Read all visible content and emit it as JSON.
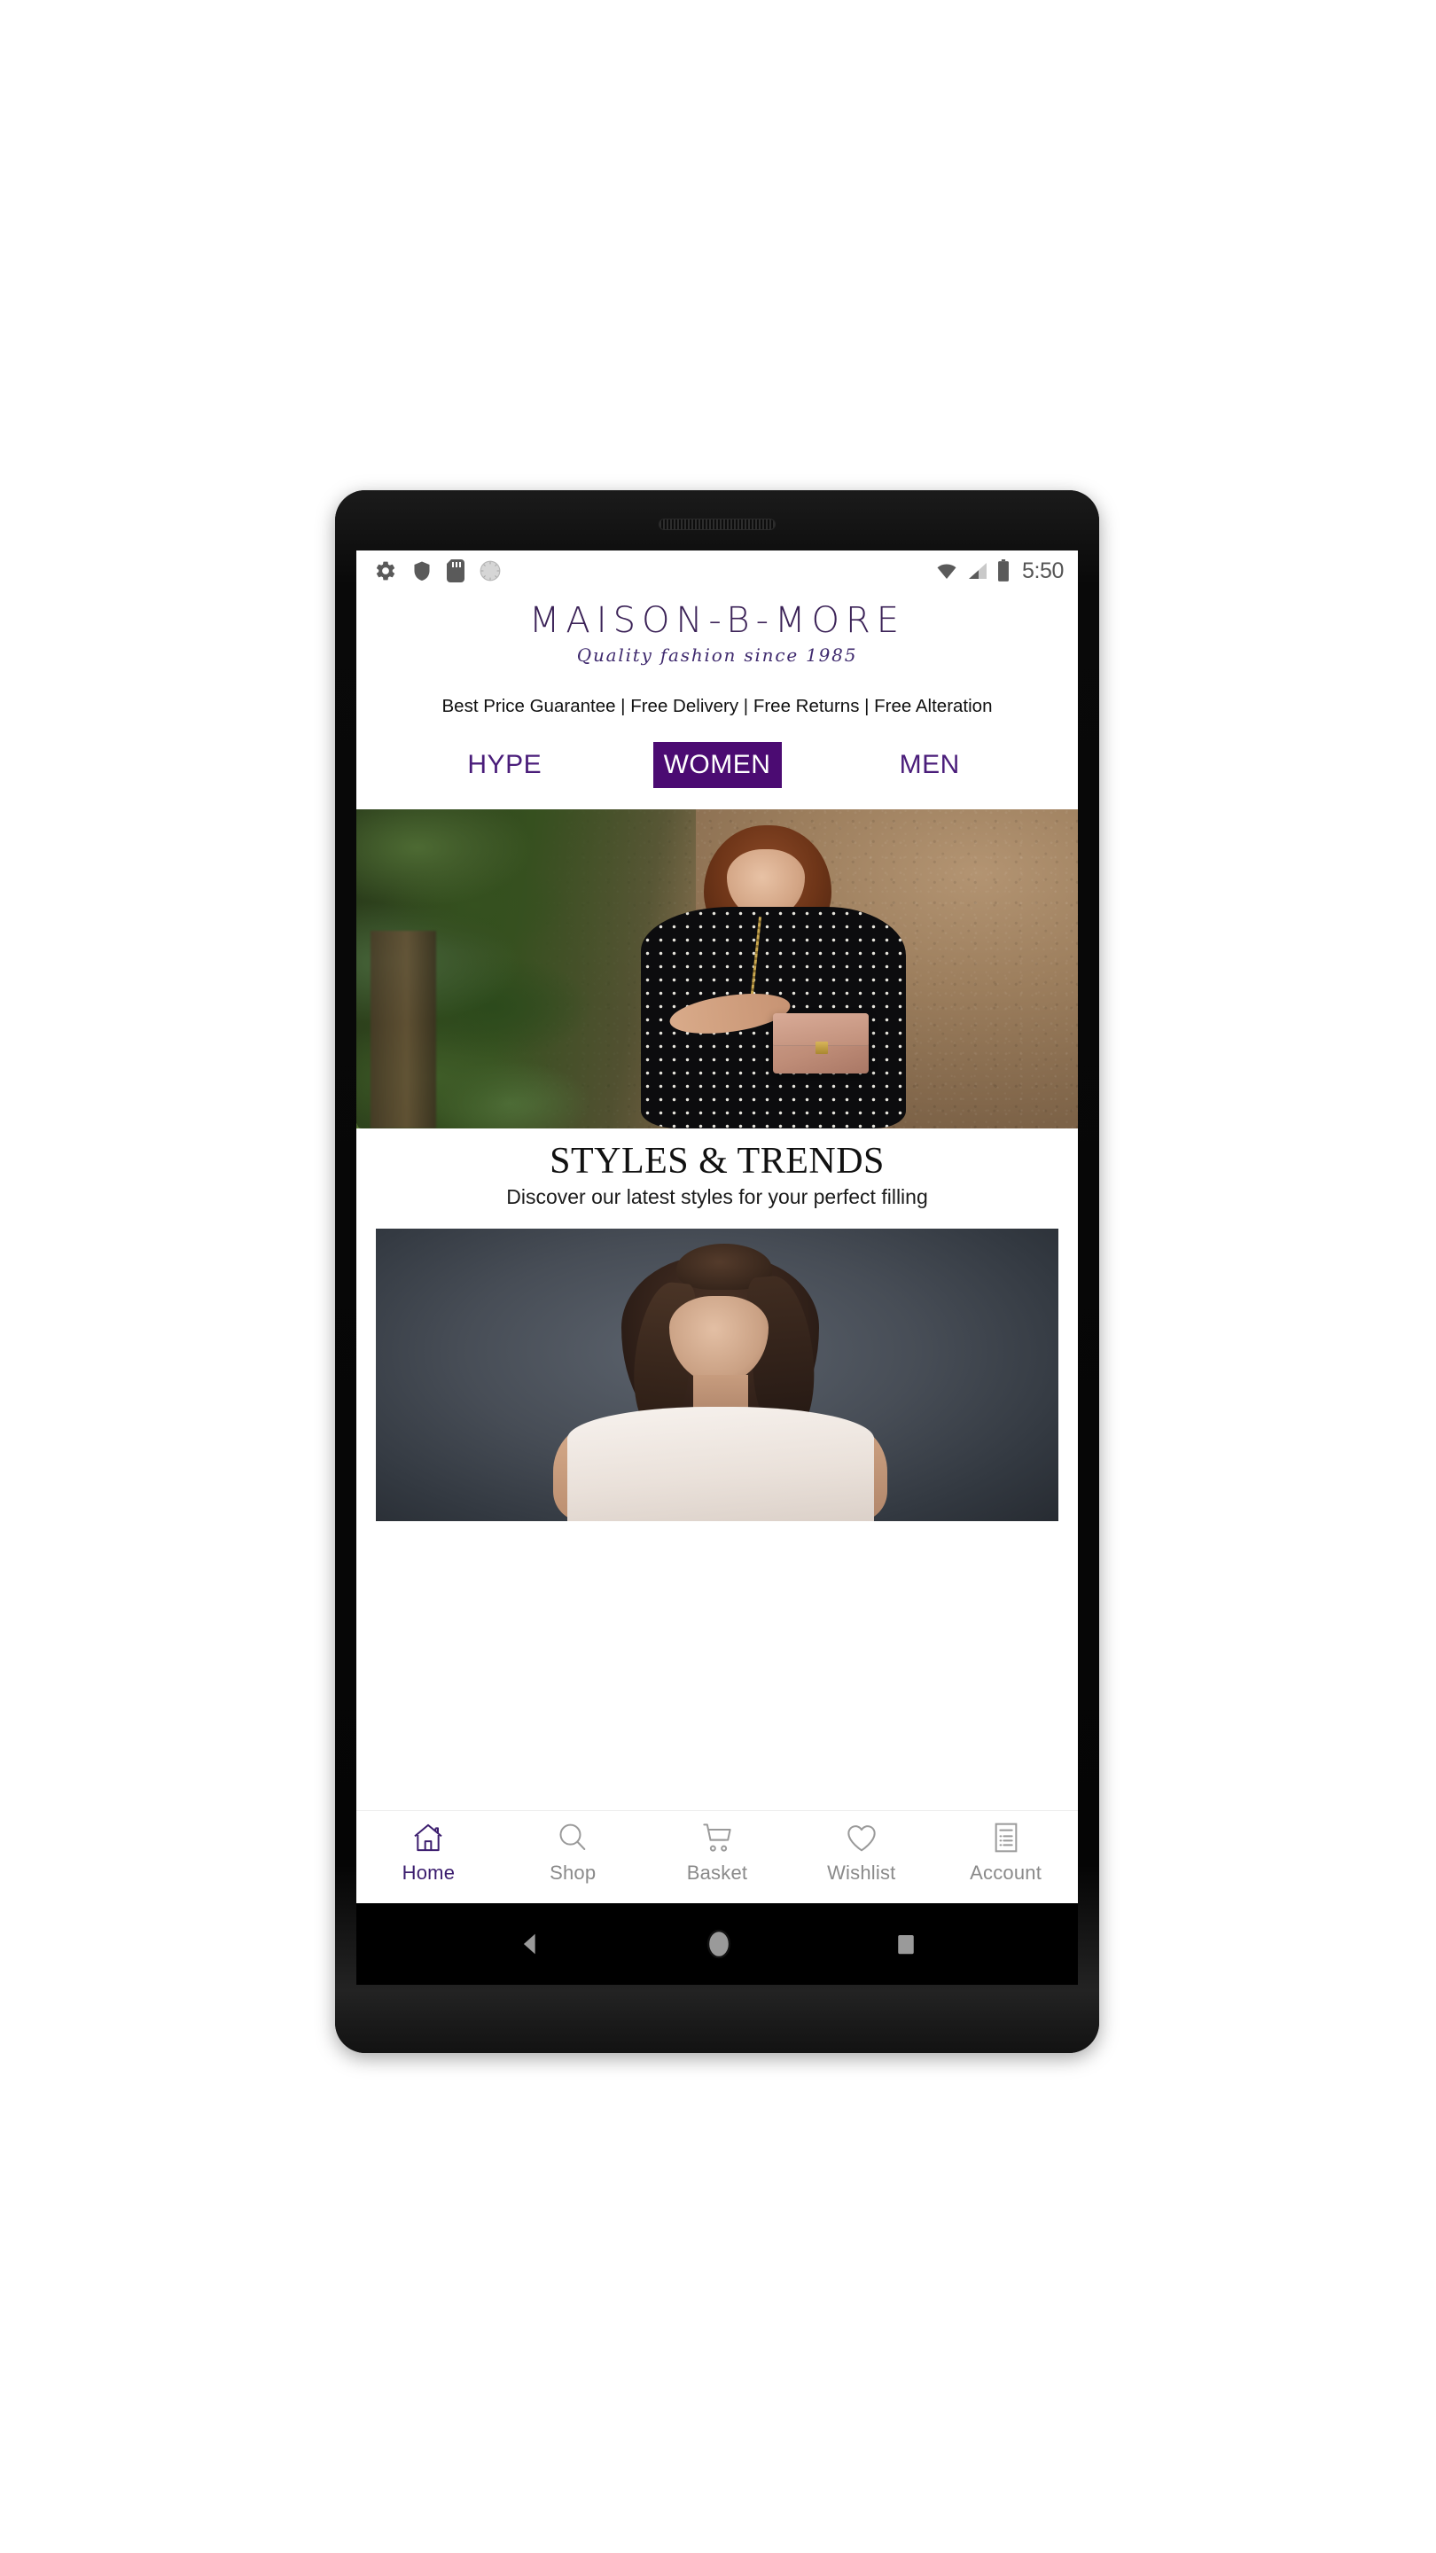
{
  "status_bar": {
    "time": "5:50",
    "left_icons": [
      "gear-icon",
      "shield-icon",
      "sd-card-icon",
      "sync-circle-icon"
    ],
    "right_icons": [
      "wifi-icon",
      "cellular-signal-icon",
      "battery-icon"
    ]
  },
  "header": {
    "brand": "MAISON-B-MORE",
    "tagline": "Quality fashion since 1985",
    "promo": "Best Price Guarantee | Free Delivery | Free Returns | Free Alteration"
  },
  "category_tabs": [
    {
      "label": "HYPE",
      "active": false
    },
    {
      "label": "WOMEN",
      "active": true
    },
    {
      "label": "MEN",
      "active": false
    }
  ],
  "hero": {
    "alt": "Woman in black polka dot dress holding a pink leather handbag beside green foliage and a stucco wall"
  },
  "styles_section": {
    "title": "STYLES & TRENDS",
    "subtitle": "Discover our latest styles for your perfect filling"
  },
  "trend_card": {
    "alt": "Portrait of a woman with brown hair wearing a white sleeveless top on a dark grey background"
  },
  "bottom_nav": [
    {
      "label": "Home",
      "icon": "home-icon",
      "active": true
    },
    {
      "label": "Shop",
      "icon": "search-icon",
      "active": false
    },
    {
      "label": "Basket",
      "icon": "cart-icon",
      "active": false
    },
    {
      "label": "Wishlist",
      "icon": "heart-icon",
      "active": false
    },
    {
      "label": "Account",
      "icon": "document-list-icon",
      "active": false
    }
  ],
  "android_nav": [
    {
      "name": "back-button",
      "icon": "triangle-back-icon"
    },
    {
      "name": "home-button",
      "icon": "circle-home-icon"
    },
    {
      "name": "recents-button",
      "icon": "square-recents-icon"
    }
  ],
  "colors": {
    "brand_purple": "#3b2257",
    "tab_active_bg": "#4b0b72",
    "tab_text": "#4a1d7a",
    "nav_inactive": "#8a8a8a",
    "nav_active": "#3b1d6e"
  }
}
